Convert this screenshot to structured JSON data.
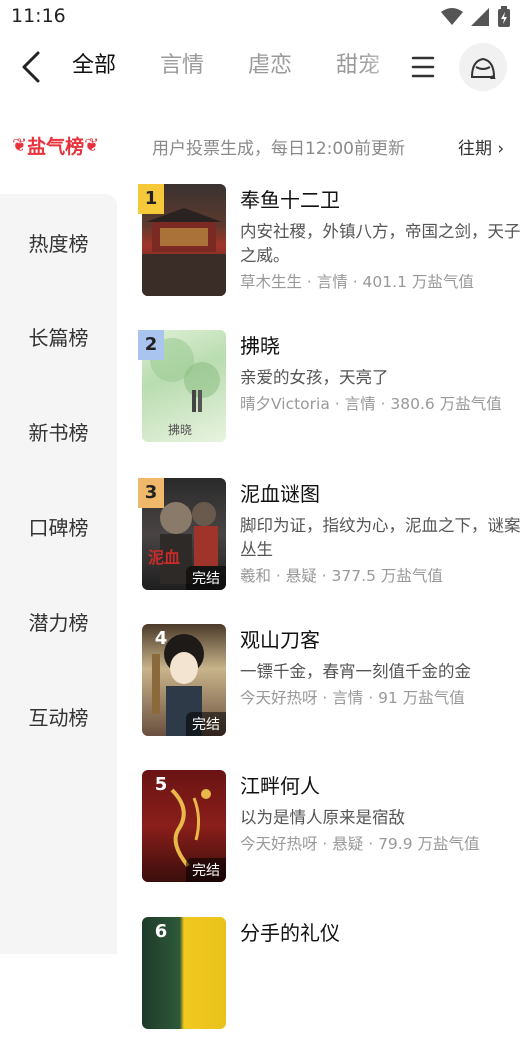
{
  "status": {
    "time": "11:16"
  },
  "nav": {
    "tabs": [
      {
        "label": "全部",
        "active": true
      },
      {
        "label": "言情",
        "active": false
      },
      {
        "label": "虐恋",
        "active": false
      },
      {
        "label": "甜宠",
        "active": false
      }
    ]
  },
  "rankbar": {
    "badge": "盐气榜",
    "description": "用户投票生成，每日12:00前更新",
    "history": "往期"
  },
  "sidebar": {
    "items": [
      "热度榜",
      "长篇榜",
      "新书榜",
      "口碑榜",
      "潜力榜",
      "互动榜"
    ]
  },
  "books": [
    {
      "rank": "1",
      "title": "奉鱼十二卫",
      "desc": "内安社稷，外镇八方，帝国之剑，天子之威。",
      "meta": "草木生生 · 言情 · 401.1 万盐气值",
      "completed": "",
      "badge_color": "#f6c93a"
    },
    {
      "rank": "2",
      "title": "拂晓",
      "desc": "亲爱的女孩，天亮了",
      "meta": "晴夕Victoria · 言情 · 380.6 万盐气值",
      "completed": "",
      "badge_color": "#a9c4ee",
      "cover_text": "拂晓"
    },
    {
      "rank": "3",
      "title": "泥血谜图",
      "desc": "脚印为证，指纹为心，泥血之下，谜案丛生",
      "meta": "羲和 · 悬疑 · 377.5 万盐气值",
      "completed": "完结",
      "badge_color": "#f0b86a",
      "cover_text": "泥血"
    },
    {
      "rank": "4",
      "title": "观山刀客",
      "desc": "一镖千金，春宵一刻值千金的金",
      "meta": "今天好热呀 · 言情 · 91 万盐气值",
      "completed": "完结"
    },
    {
      "rank": "5",
      "title": "江畔何人",
      "desc": "以为是情人原来是宿敌",
      "meta": "今天好热呀 · 悬疑 · 79.9 万盐气值",
      "completed": "完结"
    },
    {
      "rank": "6",
      "title": "分手的礼仪",
      "desc": "",
      "meta": "",
      "completed": ""
    }
  ]
}
